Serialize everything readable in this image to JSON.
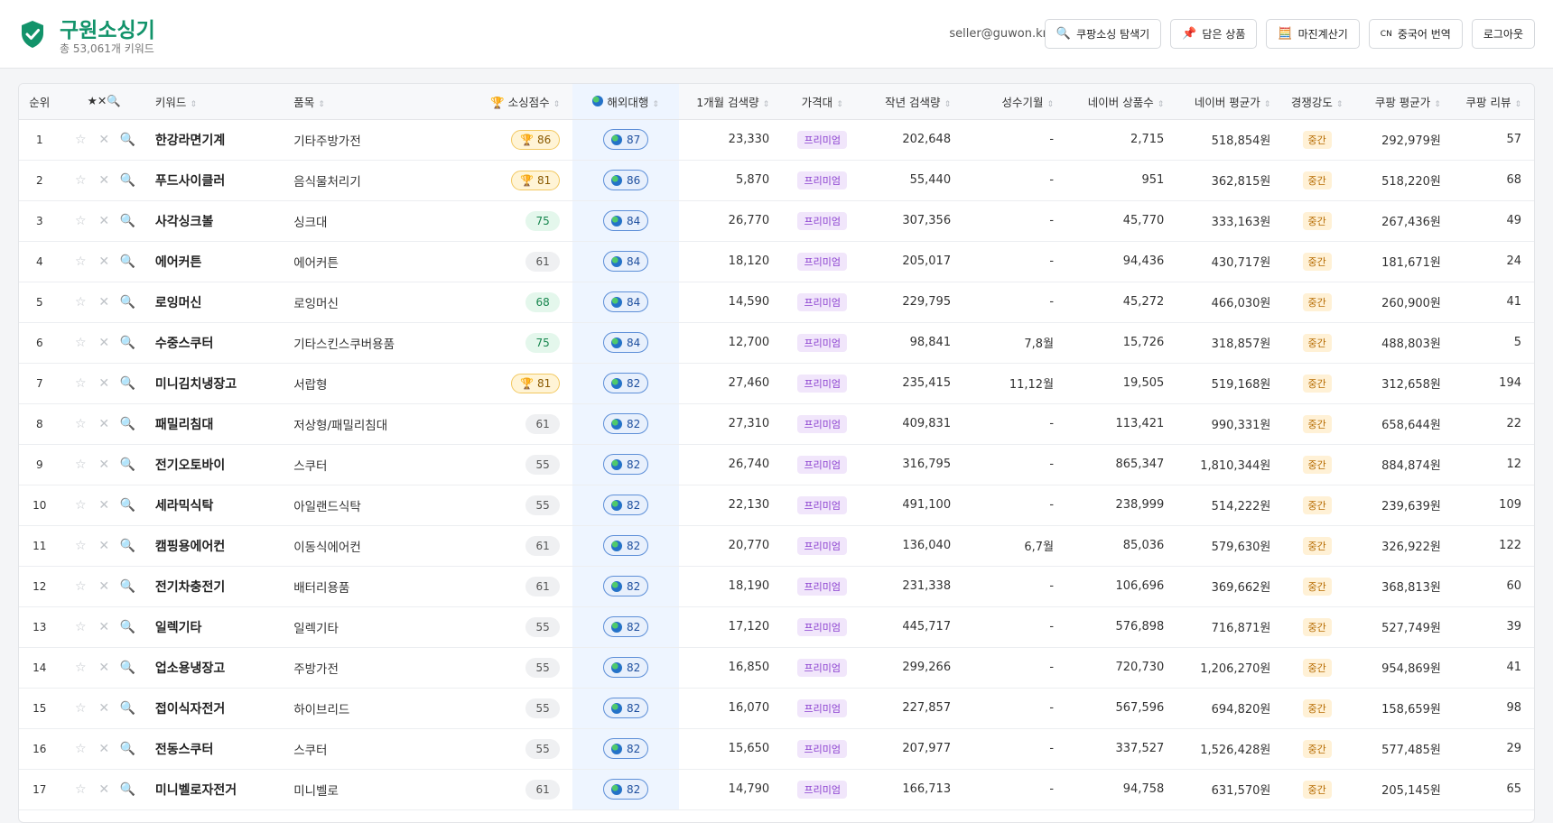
{
  "header": {
    "title": "구원소싱기",
    "subtitle": "총 53,061개 키워드",
    "user_email": "seller@guwon.kr",
    "nav": [
      {
        "icon": "🔍",
        "label": "쿠팡소싱 탐색기"
      },
      {
        "icon": "📌",
        "label": "담은 상품"
      },
      {
        "icon": "🧮",
        "label": "마진계산기"
      },
      {
        "icon": "CN",
        "label": "중국어 번역"
      },
      {
        "icon": "",
        "label": "로그아웃"
      }
    ]
  },
  "table": {
    "columns": {
      "rank": "순위",
      "actions": "★✕🔍",
      "keyword": "키워드",
      "category": "품목",
      "score": "소싱점수",
      "overseas": "해외대행",
      "monthly": "1개월 검색량",
      "price_tier": "가격대",
      "last_year": "작년 검색량",
      "season": "성수기월",
      "naver_count": "네이버 상품수",
      "naver_avg": "네이버 평균가",
      "competition": "경쟁강도",
      "coupang_avg": "쿠팡 평균가",
      "coupang_reviews": "쿠팡 리뷰"
    },
    "rows": [
      {
        "rank": "1",
        "keyword": "한강라면기계",
        "category": "기타주방가전",
        "score": "86",
        "score_tier": "gold",
        "overseas": "87",
        "monthly": "23,330",
        "price_tier": "프리미엄",
        "last_year": "202,648",
        "season": "-",
        "naver_count": "2,715",
        "naver_avg": "518,854원",
        "competition": "중간",
        "coupang_avg": "292,979원",
        "reviews": "57"
      },
      {
        "rank": "2",
        "keyword": "푸드사이클러",
        "category": "음식물처리기",
        "score": "81",
        "score_tier": "gold",
        "overseas": "86",
        "monthly": "5,870",
        "price_tier": "프리미엄",
        "last_year": "55,440",
        "season": "-",
        "naver_count": "951",
        "naver_avg": "362,815원",
        "competition": "중간",
        "coupang_avg": "518,220원",
        "reviews": "68"
      },
      {
        "rank": "3",
        "keyword": "사각싱크볼",
        "category": "싱크대",
        "score": "75",
        "score_tier": "green",
        "overseas": "84",
        "monthly": "26,770",
        "price_tier": "프리미엄",
        "last_year": "307,356",
        "season": "-",
        "naver_count": "45,770",
        "naver_avg": "333,163원",
        "competition": "중간",
        "coupang_avg": "267,436원",
        "reviews": "49"
      },
      {
        "rank": "4",
        "keyword": "에어커튼",
        "category": "에어커튼",
        "score": "61",
        "score_tier": "gray",
        "overseas": "84",
        "monthly": "18,120",
        "price_tier": "프리미엄",
        "last_year": "205,017",
        "season": "-",
        "naver_count": "94,436",
        "naver_avg": "430,717원",
        "competition": "중간",
        "coupang_avg": "181,671원",
        "reviews": "24"
      },
      {
        "rank": "5",
        "keyword": "로잉머신",
        "category": "로잉머신",
        "score": "68",
        "score_tier": "green",
        "overseas": "84",
        "monthly": "14,590",
        "price_tier": "프리미엄",
        "last_year": "229,795",
        "season": "-",
        "naver_count": "45,272",
        "naver_avg": "466,030원",
        "competition": "중간",
        "coupang_avg": "260,900원",
        "reviews": "41"
      },
      {
        "rank": "6",
        "keyword": "수중스쿠터",
        "category": "기타스킨스쿠버용품",
        "score": "75",
        "score_tier": "green",
        "overseas": "84",
        "monthly": "12,700",
        "price_tier": "프리미엄",
        "last_year": "98,841",
        "season": "7,8월",
        "naver_count": "15,726",
        "naver_avg": "318,857원",
        "competition": "중간",
        "coupang_avg": "488,803원",
        "reviews": "5"
      },
      {
        "rank": "7",
        "keyword": "미니김치냉장고",
        "category": "서랍형",
        "score": "81",
        "score_tier": "gold",
        "overseas": "82",
        "monthly": "27,460",
        "price_tier": "프리미엄",
        "last_year": "235,415",
        "season": "11,12월",
        "naver_count": "19,505",
        "naver_avg": "519,168원",
        "competition": "중간",
        "coupang_avg": "312,658원",
        "reviews": "194"
      },
      {
        "rank": "8",
        "keyword": "패밀리침대",
        "category": "저상형/패밀리침대",
        "score": "61",
        "score_tier": "gray",
        "overseas": "82",
        "monthly": "27,310",
        "price_tier": "프리미엄",
        "last_year": "409,831",
        "season": "-",
        "naver_count": "113,421",
        "naver_avg": "990,331원",
        "competition": "중간",
        "coupang_avg": "658,644원",
        "reviews": "22"
      },
      {
        "rank": "9",
        "keyword": "전기오토바이",
        "category": "스쿠터",
        "score": "55",
        "score_tier": "gray",
        "overseas": "82",
        "monthly": "26,740",
        "price_tier": "프리미엄",
        "last_year": "316,795",
        "season": "-",
        "naver_count": "865,347",
        "naver_avg": "1,810,344원",
        "competition": "중간",
        "coupang_avg": "884,874원",
        "reviews": "12"
      },
      {
        "rank": "10",
        "keyword": "세라믹식탁",
        "category": "아일랜드식탁",
        "score": "55",
        "score_tier": "gray",
        "overseas": "82",
        "monthly": "22,130",
        "price_tier": "프리미엄",
        "last_year": "491,100",
        "season": "-",
        "naver_count": "238,999",
        "naver_avg": "514,222원",
        "competition": "중간",
        "coupang_avg": "239,639원",
        "reviews": "109"
      },
      {
        "rank": "11",
        "keyword": "캠핑용에어컨",
        "category": "이동식에어컨",
        "score": "61",
        "score_tier": "gray",
        "overseas": "82",
        "monthly": "20,770",
        "price_tier": "프리미엄",
        "last_year": "136,040",
        "season": "6,7월",
        "naver_count": "85,036",
        "naver_avg": "579,630원",
        "competition": "중간",
        "coupang_avg": "326,922원",
        "reviews": "122"
      },
      {
        "rank": "12",
        "keyword": "전기차충전기",
        "category": "배터리용품",
        "score": "61",
        "score_tier": "gray",
        "overseas": "82",
        "monthly": "18,190",
        "price_tier": "프리미엄",
        "last_year": "231,338",
        "season": "-",
        "naver_count": "106,696",
        "naver_avg": "369,662원",
        "competition": "중간",
        "coupang_avg": "368,813원",
        "reviews": "60"
      },
      {
        "rank": "13",
        "keyword": "일렉기타",
        "category": "일렉기타",
        "score": "55",
        "score_tier": "gray",
        "overseas": "82",
        "monthly": "17,120",
        "price_tier": "프리미엄",
        "last_year": "445,717",
        "season": "-",
        "naver_count": "576,898",
        "naver_avg": "716,871원",
        "competition": "중간",
        "coupang_avg": "527,749원",
        "reviews": "39"
      },
      {
        "rank": "14",
        "keyword": "업소용냉장고",
        "category": "주방가전",
        "score": "55",
        "score_tier": "gray",
        "overseas": "82",
        "monthly": "16,850",
        "price_tier": "프리미엄",
        "last_year": "299,266",
        "season": "-",
        "naver_count": "720,730",
        "naver_avg": "1,206,270원",
        "competition": "중간",
        "coupang_avg": "954,869원",
        "reviews": "41"
      },
      {
        "rank": "15",
        "keyword": "접이식자전거",
        "category": "하이브리드",
        "score": "55",
        "score_tier": "gray",
        "overseas": "82",
        "monthly": "16,070",
        "price_tier": "프리미엄",
        "last_year": "227,857",
        "season": "-",
        "naver_count": "567,596",
        "naver_avg": "694,820원",
        "competition": "중간",
        "coupang_avg": "158,659원",
        "reviews": "98"
      },
      {
        "rank": "16",
        "keyword": "전동스쿠터",
        "category": "스쿠터",
        "score": "55",
        "score_tier": "gray",
        "overseas": "82",
        "monthly": "15,650",
        "price_tier": "프리미엄",
        "last_year": "207,977",
        "season": "-",
        "naver_count": "337,527",
        "naver_avg": "1,526,428원",
        "competition": "중간",
        "coupang_avg": "577,485원",
        "reviews": "29"
      },
      {
        "rank": "17",
        "keyword": "미니벨로자전거",
        "category": "미니벨로",
        "score": "61",
        "score_tier": "gray",
        "overseas": "82",
        "monthly": "14,790",
        "price_tier": "프리미엄",
        "last_year": "166,713",
        "season": "-",
        "naver_count": "94,758",
        "naver_avg": "631,570원",
        "competition": "중간",
        "coupang_avg": "205,145원",
        "reviews": "65"
      }
    ]
  },
  "colors": {
    "brand": "#12936a",
    "premium": "#8a3fcf",
    "mid": "#b66b00",
    "overseas": "#1e4f9e"
  }
}
